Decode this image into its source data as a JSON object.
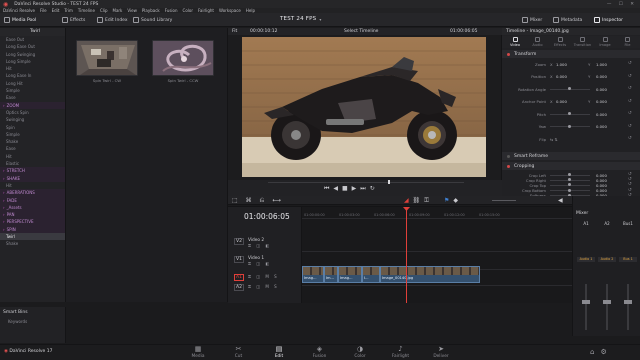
{
  "window": {
    "title": "DaVinci Resolve Studio - TEST 24 FPS"
  },
  "menu": [
    "DaVinci Resolve",
    "File",
    "Edit",
    "Trim",
    "Timeline",
    "Clip",
    "Mark",
    "View",
    "Playback",
    "Fusion",
    "Color",
    "Fairlight",
    "Workspace",
    "Help"
  ],
  "toolbar": {
    "media_pool": "Media Pool",
    "effects": "Effects",
    "edit_index": "Edit Index",
    "sound_library": "Sound Library",
    "project_title": "TEST 24 FPS",
    "mixer": "Mixer",
    "metadata": "Metadata",
    "inspector": "Inspector"
  },
  "sidebar": {
    "header": "Twirl",
    "items": [
      {
        "label": "Ease Out",
        "kind": "item"
      },
      {
        "label": "Long Ease Out",
        "kind": "item"
      },
      {
        "label": "Long Swinging",
        "kind": "item"
      },
      {
        "label": "Long Simple",
        "kind": "item"
      },
      {
        "label": "Hit",
        "kind": "item"
      },
      {
        "label": "Long Ease In",
        "kind": "item"
      },
      {
        "label": "Long Hit",
        "kind": "item"
      },
      {
        "label": "Simple",
        "kind": "item"
      },
      {
        "label": "Ease",
        "kind": "item"
      },
      {
        "label": "ZOOM",
        "kind": "folder"
      },
      {
        "label": "Optics Spin",
        "kind": "item"
      },
      {
        "label": "Swinging",
        "kind": "item"
      },
      {
        "label": "Spin",
        "kind": "item"
      },
      {
        "label": "Simple",
        "kind": "item"
      },
      {
        "label": "Shake",
        "kind": "item"
      },
      {
        "label": "Ease",
        "kind": "item"
      },
      {
        "label": "Hit",
        "kind": "item"
      },
      {
        "label": "Elastic",
        "kind": "item"
      },
      {
        "label": "STRETCH",
        "kind": "folder"
      },
      {
        "label": "SHAKE",
        "kind": "folder"
      },
      {
        "label": "Hit",
        "kind": "item"
      },
      {
        "label": "ABERRATIONS",
        "kind": "folder"
      },
      {
        "label": "FADE",
        "kind": "folder"
      },
      {
        "label": "_Assets",
        "kind": "folder"
      },
      {
        "label": "PAN",
        "kind": "folder"
      },
      {
        "label": "PERSPECTIVE",
        "kind": "folder"
      },
      {
        "label": "SPIN",
        "kind": "folder"
      },
      {
        "label": "Twirl",
        "kind": "selected"
      },
      {
        "label": "Shake",
        "kind": "item"
      }
    ],
    "smart_bins": "Smart Bins",
    "keywords": "Keywords"
  },
  "pool": {
    "clips": [
      {
        "label": "Spin Twirl - CW"
      },
      {
        "label": "Spin Twirl - CCW"
      }
    ]
  },
  "viewer": {
    "zoom": "Fit",
    "timecode_left": "00:00:10:12",
    "timeline_name": "Select Timeline",
    "timecode_right": "01:00:06:05"
  },
  "inspector": {
    "title": "Timeline - Image_00140.jpg",
    "tabs": [
      "Video",
      "Audio",
      "Effects",
      "Transition",
      "Image",
      "File"
    ],
    "transform": "Transform",
    "rows": [
      {
        "label": "Zoom",
        "x_label": "X",
        "x": "1.000",
        "y_label": "Y",
        "y": "1.000"
      },
      {
        "label": "Position",
        "x_label": "X",
        "x": "0.000",
        "y_label": "Y",
        "y": "0.000"
      },
      {
        "label": "Rotation Angle",
        "v": "0.000"
      },
      {
        "label": "Anchor Point",
        "x_label": "X",
        "x": "0.000",
        "y_label": "Y",
        "y": "0.000"
      },
      {
        "label": "Pitch",
        "v": "0.000"
      },
      {
        "label": "Yaw",
        "v": "0.000"
      },
      {
        "label": "Flip"
      }
    ],
    "smart_reframe": "Smart Reframe",
    "cropping": "Cropping",
    "crop_rows": [
      {
        "label": "Crop Left",
        "v": "0.000"
      },
      {
        "label": "Crop Right",
        "v": "0.000"
      },
      {
        "label": "Crop Top",
        "v": "0.000"
      },
      {
        "label": "Crop Bottom",
        "v": "0.000"
      },
      {
        "label": "Softness",
        "v": "0.000"
      }
    ]
  },
  "timeline": {
    "timecode": "01:00:06:05",
    "ruler": [
      "01:00:00:00",
      "01:00:03:00",
      "01:00:06:00",
      "01:00:09:00",
      "01:00:12:00",
      "01:00:15:00"
    ],
    "tracks": [
      {
        "id": "V2",
        "name": "Video 2"
      },
      {
        "id": "V1",
        "name": "Video 1"
      },
      {
        "id": "A1",
        "name": ""
      },
      {
        "id": "A2",
        "name": ""
      }
    ],
    "clips": [
      {
        "label": "Imag..."
      },
      {
        "label": "Im..."
      },
      {
        "label": "Imag..."
      },
      {
        "label": "I..."
      },
      {
        "label": "Image_00140.jpg"
      }
    ]
  },
  "mixer": {
    "title": "Mixer",
    "channels": [
      "A1",
      "A2",
      "Bus1"
    ],
    "inputs": [
      "Audio 1",
      "Audio 2",
      "Bus 1"
    ]
  },
  "pages": [
    "Media",
    "Cut",
    "Edit",
    "Fusion",
    "Color",
    "Fairlight",
    "Deliver"
  ],
  "active_page": "Edit",
  "footer": {
    "app": "DaVinci Resolve 17"
  },
  "colors": {
    "accent_red": "#e0403a",
    "accent_purple": "#b06ad0",
    "clip_blue": "#34506e"
  },
  "icons": [
    "media-pool-icon",
    "effects-icon",
    "edit-index-icon",
    "sound-library-icon",
    "mixer-icon",
    "metadata-icon",
    "inspector-icon",
    "play-icon",
    "stop-icon",
    "loop-icon",
    "razor-icon",
    "link-icon",
    "flag-icon",
    "lock-icon",
    "speaker-icon",
    "film-icon",
    "music-icon",
    "home-icon",
    "gear-icon"
  ]
}
